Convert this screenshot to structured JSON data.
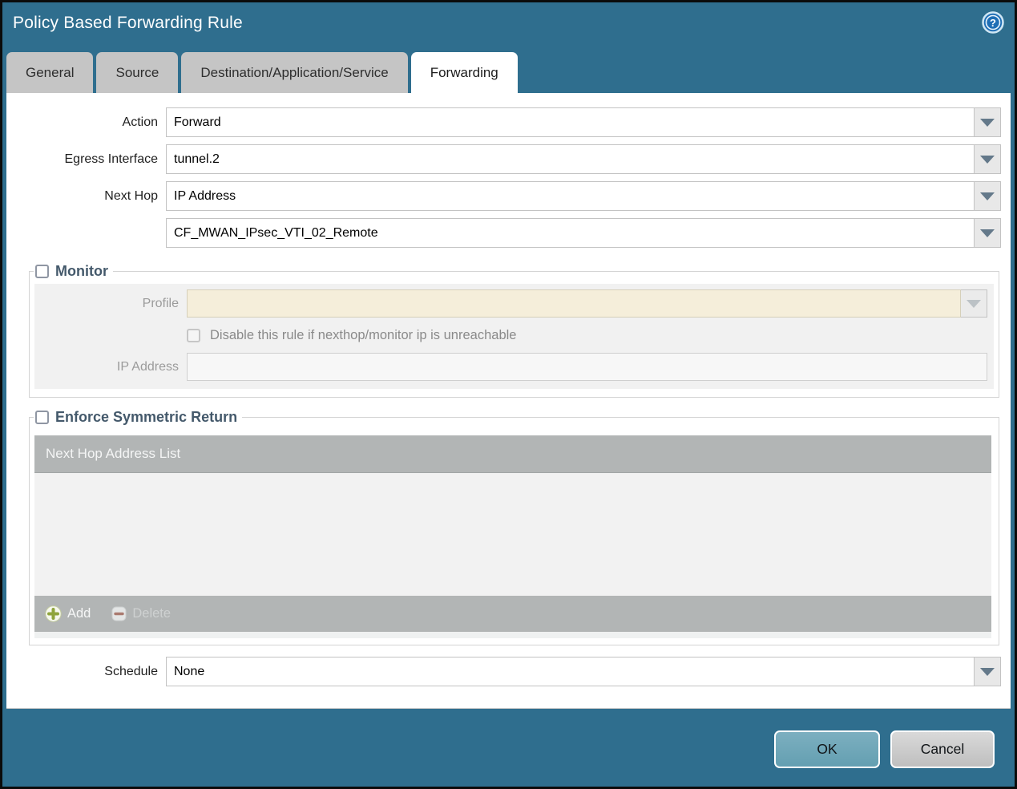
{
  "window": {
    "title": "Policy Based Forwarding Rule"
  },
  "tabs": [
    {
      "label": "General",
      "active": false
    },
    {
      "label": "Source",
      "active": false
    },
    {
      "label": "Destination/Application/Service",
      "active": false
    },
    {
      "label": "Forwarding",
      "active": true
    }
  ],
  "form": {
    "action": {
      "label": "Action",
      "value": "Forward"
    },
    "egress_interface": {
      "label": "Egress Interface",
      "value": "tunnel.2"
    },
    "next_hop": {
      "label": "Next Hop",
      "value": "IP Address"
    },
    "next_hop_address": {
      "value": "CF_MWAN_IPsec_VTI_02_Remote"
    },
    "schedule": {
      "label": "Schedule",
      "value": "None"
    }
  },
  "monitor": {
    "title": "Monitor",
    "checked": false,
    "profile": {
      "label": "Profile",
      "value": ""
    },
    "disable_rule_label": "Disable this rule if nexthop/monitor ip is unreachable",
    "ip_address": {
      "label": "IP Address",
      "value": ""
    }
  },
  "symmetric_return": {
    "title": "Enforce Symmetric Return",
    "checked": false,
    "table_header": "Next Hop Address List",
    "rows": [],
    "add_label": "Add",
    "delete_label": "Delete"
  },
  "footer": {
    "ok_label": "OK",
    "cancel_label": "Cancel"
  },
  "icons": {
    "help": "help-icon",
    "dropdown": "chevron-down-icon",
    "add": "plus-icon",
    "delete": "minus-icon"
  },
  "colors": {
    "titlebar_teal": "#2f6e8e",
    "tab_inactive": "#c5c5c5",
    "table_gray": "#b2b5b5",
    "disabled_beige": "#f5eeda",
    "ok_button": "#6fa6b8",
    "add_plus_green": "#8fa43c",
    "delete_minus_red": "#aa7b70"
  }
}
